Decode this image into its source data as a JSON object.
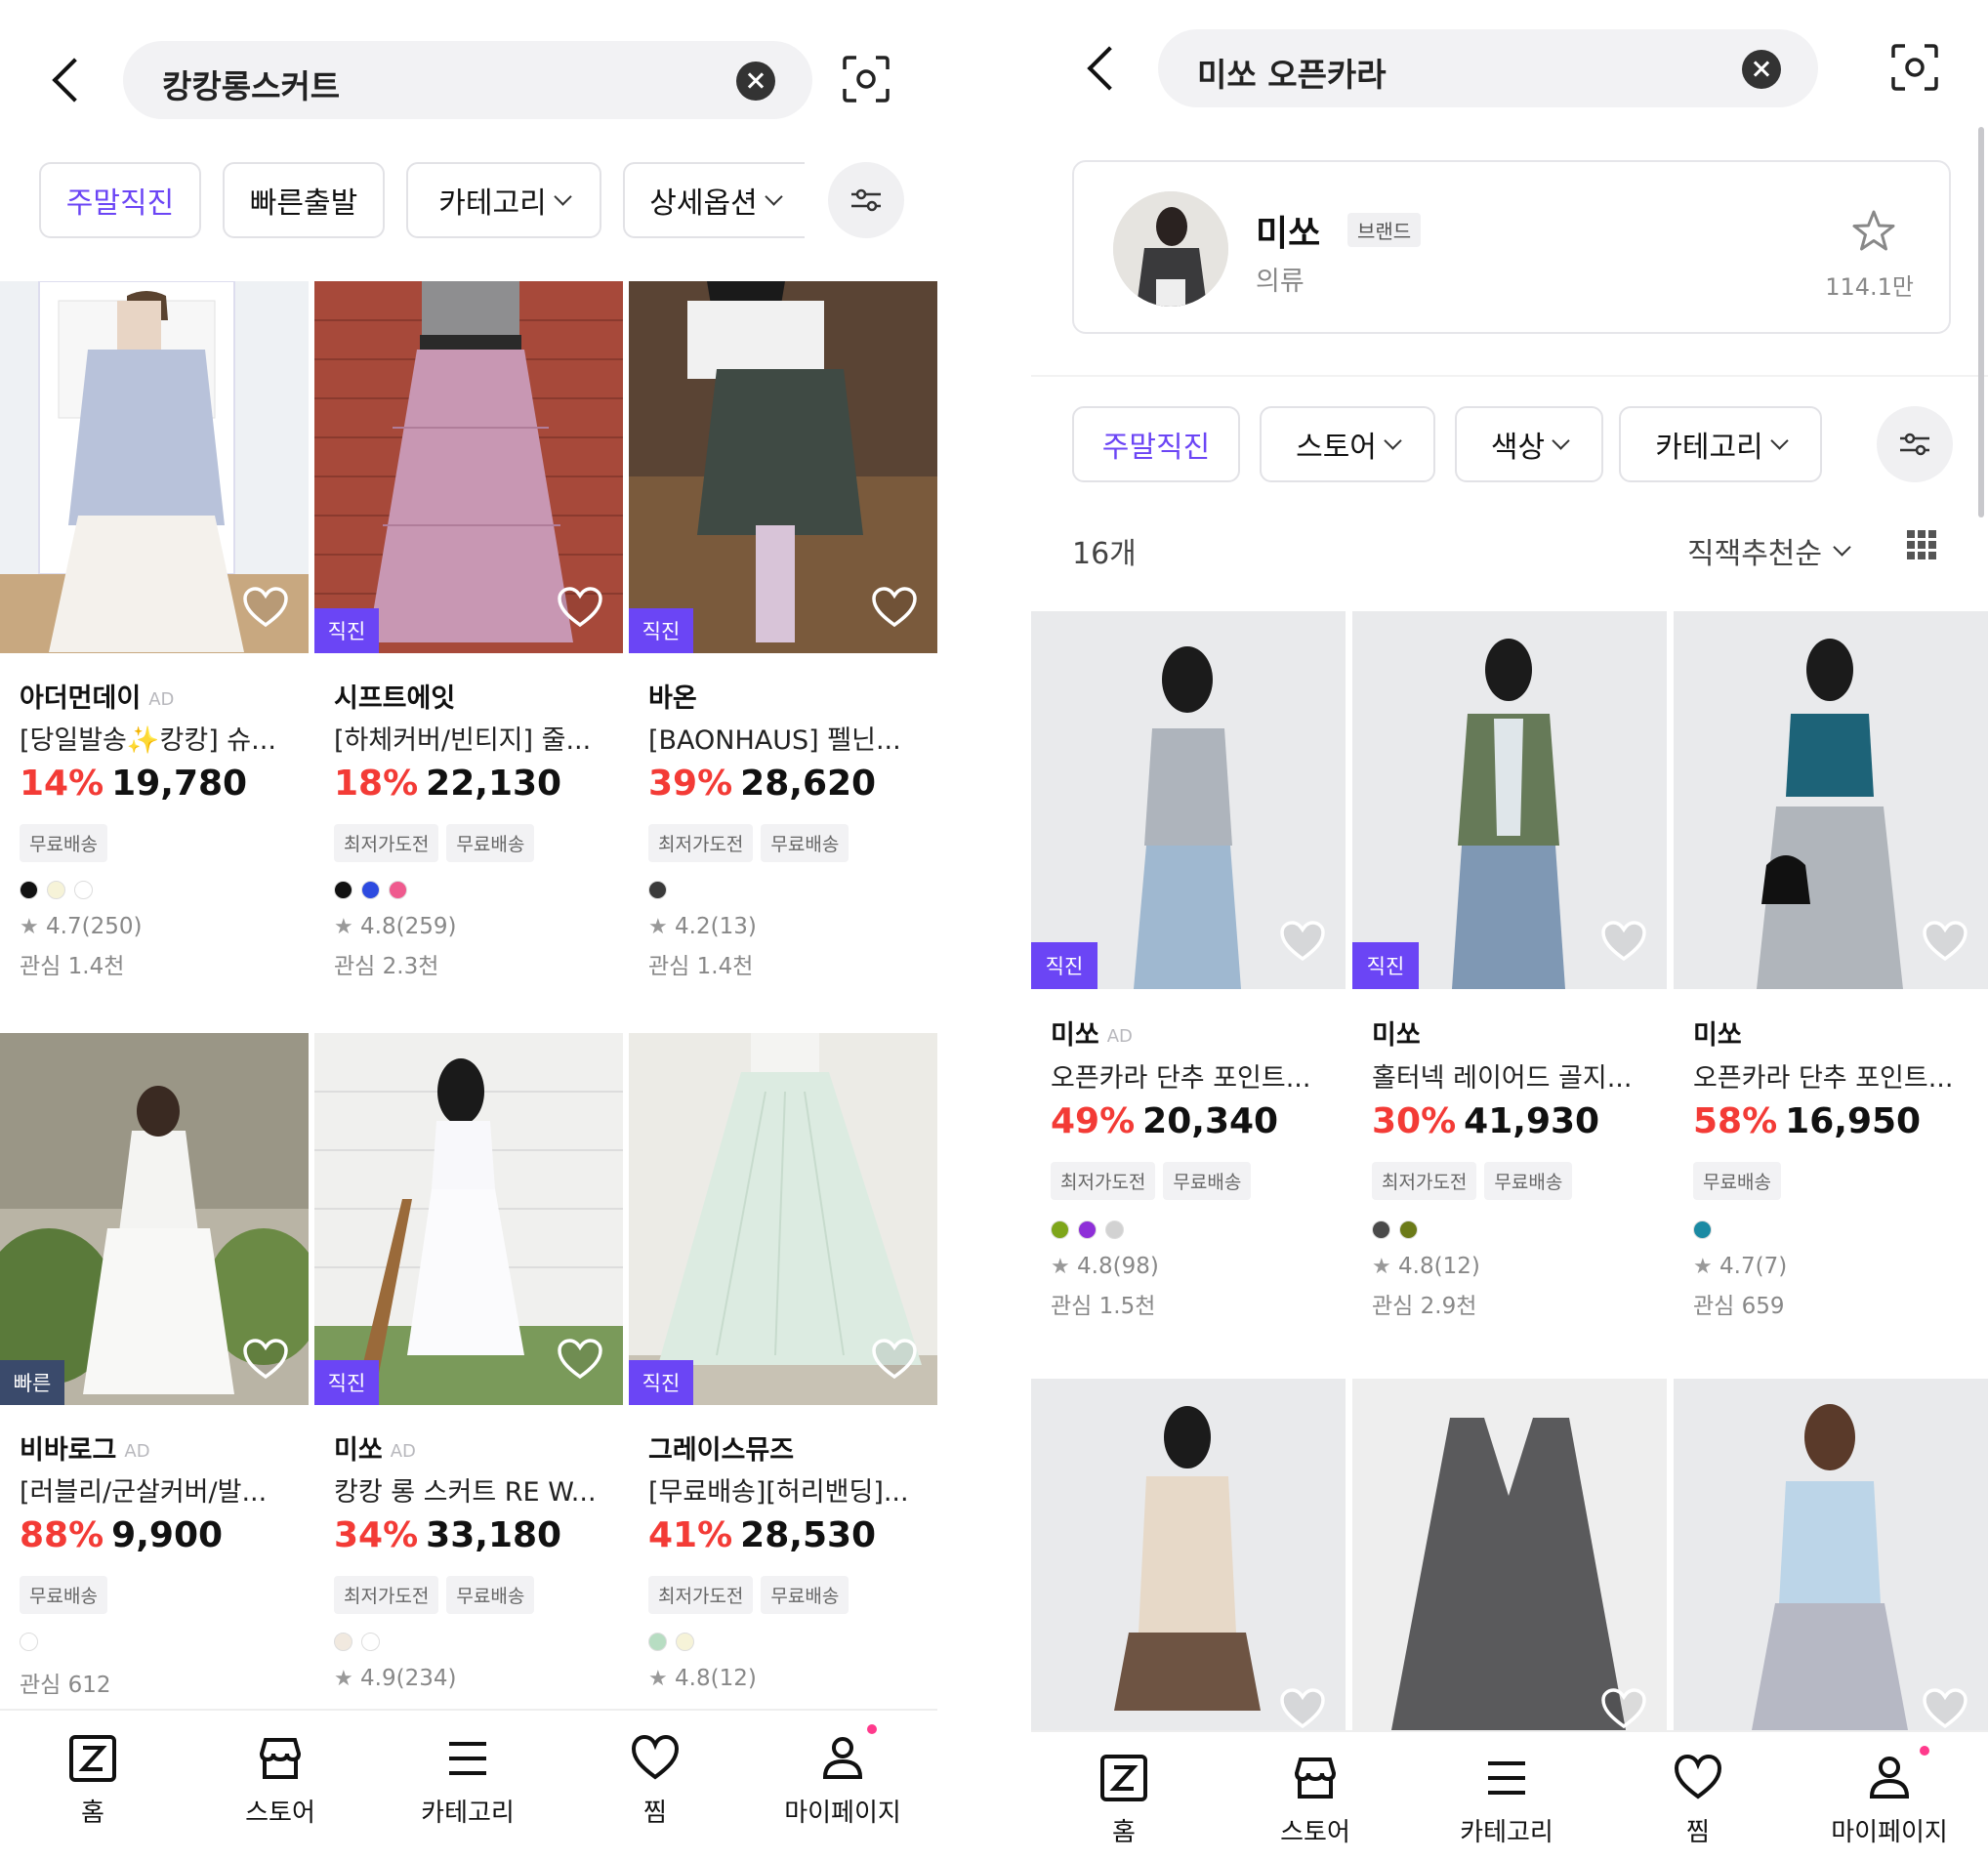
{
  "left": {
    "search": {
      "query": "캉캉롱스커트"
    },
    "chips": [
      "주말직진",
      "빠른출발",
      "카테고리",
      "상세옵션"
    ],
    "products": [
      {
        "brand": "아더먼데이",
        "ad": "AD",
        "title": "[당일발송✨캉캉] 슈...",
        "discount": "14%",
        "price": "19,780",
        "badge": "",
        "tags": [
          "무료배송"
        ],
        "colors": [
          "#111111",
          "#f6f3d8",
          "#ffffff"
        ],
        "rating": "4.7(250)",
        "interest": "관심 1.4천"
      },
      {
        "brand": "시프트에잇",
        "ad": "",
        "title": "[하체커버/빈티지] 줄...",
        "discount": "18%",
        "price": "22,130",
        "badge": "직진",
        "tags": [
          "최저가도전",
          "무료배송"
        ],
        "colors": [
          "#111111",
          "#2d4be0",
          "#ef5a8e"
        ],
        "rating": "4.8(259)",
        "interest": "관심 2.3천"
      },
      {
        "brand": "바온",
        "ad": "",
        "title": "[BAONHAUS] 펠닌...",
        "discount": "39%",
        "price": "28,620",
        "badge": "직진",
        "tags": [
          "최저가도전",
          "무료배송"
        ],
        "colors": [
          "#3a3a3a"
        ],
        "rating": "4.2(13)",
        "interest": "관심 1.4천"
      },
      {
        "brand": "비바로그",
        "ad": "AD",
        "title": "[러블리/군살커버/발...",
        "discount": "88%",
        "price": "9,900",
        "badge": "빠른",
        "tags": [
          "무료배송"
        ],
        "colors": [
          "#ffffff"
        ],
        "rating": "",
        "interest": "관심 612"
      },
      {
        "brand": "미쏘",
        "ad": "AD",
        "title": "캉캉 롱 스커트 RE W...",
        "discount": "34%",
        "price": "33,180",
        "badge": "직진",
        "tags": [
          "최저가도전",
          "무료배송"
        ],
        "colors": [
          "#f1e9df",
          "#ffffff"
        ],
        "rating": "4.9(234)",
        "interest": ""
      },
      {
        "brand": "그레이스뮤즈",
        "ad": "",
        "title": "[무료배송][허리밴딩]...",
        "discount": "41%",
        "price": "28,530",
        "badge": "직진",
        "tags": [
          "최저가도전",
          "무료배송"
        ],
        "colors": [
          "#b7ddc2",
          "#f6f3d8"
        ],
        "rating": "4.8(12)",
        "interest": ""
      }
    ]
  },
  "right": {
    "search": {
      "query": "미쏘 오픈카라"
    },
    "brand_card": {
      "name": "미쏘",
      "kind": "브랜드",
      "category": "의류",
      "favorites": "114.1만"
    },
    "chips": [
      "주말직진",
      "스토어",
      "색상",
      "카테고리"
    ],
    "count": "16개",
    "sort": "직잭추천순",
    "products": [
      {
        "brand": "미쏘",
        "ad": "AD",
        "title": "오픈카라 단추 포인트...",
        "discount": "49%",
        "price": "20,340",
        "badge": "직진",
        "tags": [
          "최저가도전",
          "무료배송"
        ],
        "colors": [
          "#7ea61a",
          "#8e2fd8",
          "#d2d2d2"
        ],
        "rating": "4.8(98)",
        "interest": "관심 1.5천"
      },
      {
        "brand": "미쏘",
        "ad": "",
        "title": "홀터넥 레이어드 골지...",
        "discount": "30%",
        "price": "41,930",
        "badge": "직진",
        "tags": [
          "최저가도전",
          "무료배송"
        ],
        "colors": [
          "#4a4a4a",
          "#6b7a18"
        ],
        "rating": "4.8(12)",
        "interest": "관심 2.9천"
      },
      {
        "brand": "미쏘",
        "ad": "",
        "title": "오픈카라 단추 포인트...",
        "discount": "58%",
        "price": "16,950",
        "badge": "",
        "tags": [
          "무료배송"
        ],
        "colors": [
          "#1b8aa3"
        ],
        "rating": "4.7(7)",
        "interest": "관심 659"
      }
    ]
  },
  "bottom_nav": [
    {
      "label": "홈",
      "icon": "home-z-icon"
    },
    {
      "label": "스토어",
      "icon": "store-icon"
    },
    {
      "label": "카테고리",
      "icon": "menu-icon"
    },
    {
      "label": "찜",
      "icon": "heart-icon"
    },
    {
      "label": "마이페이지",
      "icon": "user-icon"
    }
  ],
  "colors": {
    "accent": "#6b45f5",
    "discount": "#f33b36",
    "badge_fast": "#3a4a6b",
    "notification_dot": "#ff3a8c"
  }
}
